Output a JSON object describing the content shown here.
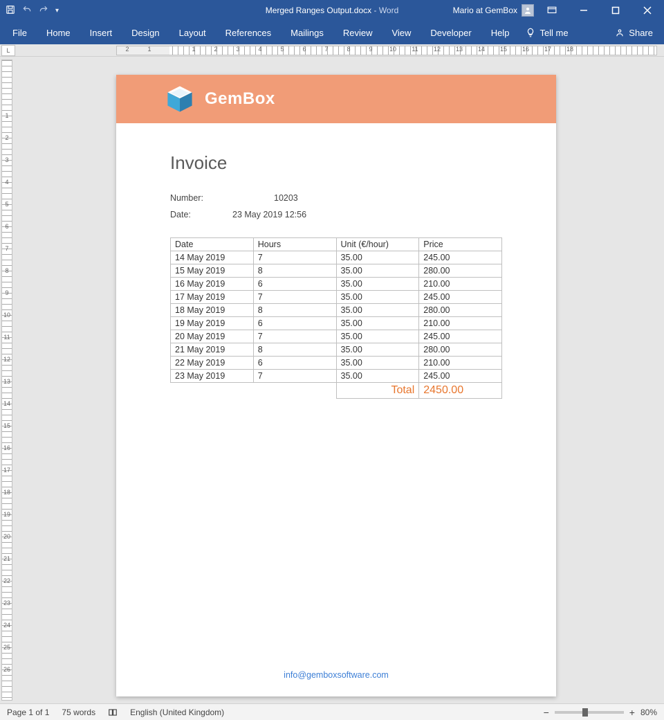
{
  "titlebar": {
    "doc_name": "Merged Ranges Output.docx",
    "sep": " - ",
    "app_name": "Word",
    "user": "Mario at GemBox"
  },
  "ribbon": {
    "tabs": [
      "File",
      "Home",
      "Insert",
      "Design",
      "Layout",
      "References",
      "Mailings",
      "Review",
      "View",
      "Developer",
      "Help"
    ],
    "tellme": "Tell me",
    "share": "Share"
  },
  "ruler_h": [
    "2",
    "1",
    "",
    "1",
    "2",
    "3",
    "4",
    "5",
    "6",
    "7",
    "8",
    "9",
    "10",
    "11",
    "12",
    "13",
    "14",
    "15",
    "16",
    "17",
    "18"
  ],
  "ruler_v": [
    "",
    "",
    "1",
    "2",
    "3",
    "4",
    "5",
    "6",
    "7",
    "8",
    "9",
    "10",
    "11",
    "12",
    "13",
    "14",
    "15",
    "16",
    "17",
    "18",
    "19",
    "20",
    "21",
    "22",
    "23",
    "24",
    "25",
    "26"
  ],
  "document": {
    "brand": "GemBox",
    "title": "Invoice",
    "meta": {
      "number_label": "Number:",
      "number_value": "10203",
      "date_label": "Date:",
      "date_value": "23 May 2019 12:56"
    },
    "table": {
      "headers": [
        "Date",
        "Hours",
        "Unit (€/hour)",
        "Price"
      ],
      "rows": [
        [
          "14 May 2019",
          "7",
          "35.00",
          "245.00"
        ],
        [
          "15 May 2019",
          "8",
          "35.00",
          "280.00"
        ],
        [
          "16 May 2019",
          "6",
          "35.00",
          "210.00"
        ],
        [
          "17 May 2019",
          "7",
          "35.00",
          "245.00"
        ],
        [
          "18 May 2019",
          "8",
          "35.00",
          "280.00"
        ],
        [
          "19 May 2019",
          "6",
          "35.00",
          "210.00"
        ],
        [
          "20 May 2019",
          "7",
          "35.00",
          "245.00"
        ],
        [
          "21 May 2019",
          "8",
          "35.00",
          "280.00"
        ],
        [
          "22 May 2019",
          "6",
          "35.00",
          "210.00"
        ],
        [
          "23 May 2019",
          "7",
          "35.00",
          "245.00"
        ]
      ],
      "total_label": "Total",
      "total_value": "2450.00"
    },
    "footer_link": "info@gemboxsoftware.com"
  },
  "statusbar": {
    "page": "Page 1 of 1",
    "words": "75 words",
    "language": "English (United Kingdom)",
    "zoom": "80%"
  }
}
